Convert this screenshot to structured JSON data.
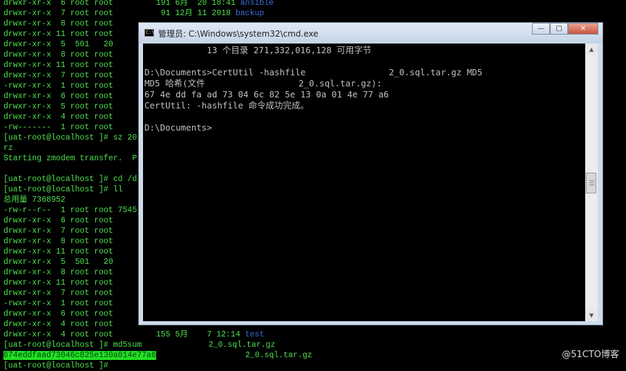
{
  "terminal": {
    "lines": [
      "drwxr-xr-x  6 root root         191 6月  20 18:41 ",
      "drwxr-xr-x  7 root root          91 12月 11 2018 ",
      "drwxr-xr-x  8 root root",
      "drwxr-xr-x 11 root root",
      "drwxr-xr-x  5  501   20",
      "drwxr-xr-x  8 root root",
      "drwxr-xr-x 11 root root",
      "drwxr-xr-x  7 root root",
      "-rwxr-xr-x  1 root root",
      "drwxr-xr-x  6 root root",
      "drwxr-xr-x  5 root root",
      "drwxr-xr-x  4 root root",
      "-rw-------  1 root root",
      "[uat-root@localhost ]# sz 20",
      "rz",
      "Starting zmodem transfer.  P",
      "",
      "[uat-root@localhost ]# cd /d",
      "[uat-root@localhost ]# ll",
      "总用量 7368952",
      "-rw-r--r--  1 root root 7545",
      "drwxr-xr-x  6 root root",
      "drwxr-xr-x  7 root root",
      "drwxr-xr-x  8 root root",
      "drwxr-xr-x 11 root root",
      "drwxr-xr-x  5  501   20",
      "drwxr-xr-x  8 root root",
      "drwxr-xr-x 11 root root",
      "drwxr-xr-x  7 root root",
      "-rwxr-xr-x  1 root root",
      "drwxr-xr-x  6 root root",
      "drwxr-xr-x  4 root root",
      "drwxr-xr-x  4 root root         155 5月    7 12:14 ",
      "[uat-root@localhost ]# md5sum              2_0.sql.tar.gz",
      "",
      "[uat-root@localhost ]# "
    ],
    "line1_name": "ansible",
    "line2_name": "backup",
    "line33_name": "test",
    "md5_result": "674eddfaad73046c825e130a014e77a6",
    "md5_result_file": "2_0.sql.tar.gz"
  },
  "cmd_window": {
    "title": "管理员: C:\\Windows\\system32\\cmd.exe",
    "icon_text": "C:\\",
    "buttons": {
      "minimize": "—",
      "maximize": "□",
      "close": "✕"
    },
    "console_lines": [
      "            13 个目录 271,332,016,128 可用字节",
      "",
      "D:\\Documents>CertUtil -hashfile                2_0.sql.tar.gz MD5",
      "MD5 哈希(文件                  2_0.sql.tar.gz):",
      "67 4e dd fa ad 73 04 6c 82 5e 13 0a 01 4e 77 a6",
      "CertUtil: -hashfile 命令成功完成。",
      "",
      "D:\\Documents>"
    ],
    "scroll_up": "▲",
    "scroll_down": "▼"
  },
  "watermark": "@51CTO博客"
}
